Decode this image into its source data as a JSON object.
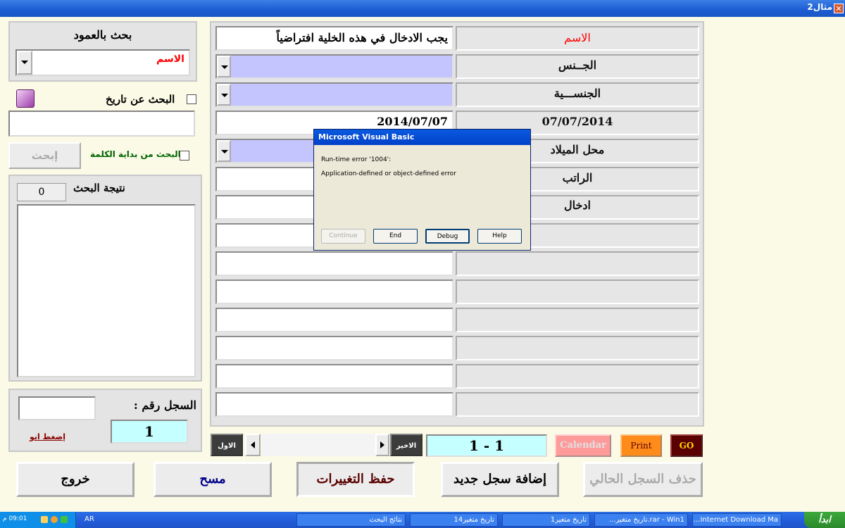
{
  "window": {
    "title": "مثال2",
    "close_glyph": "✕"
  },
  "search": {
    "column_label": "بحث بالعمود",
    "column_value": "الاسم",
    "date_checkbox_label": "البحث عن تاريخ",
    "word_start_label": "البحث من بداية الكلمة",
    "search_button": "إبحث",
    "result_label": "نتيجة البحث",
    "result_count": "0"
  },
  "record": {
    "label": "السجل رقم :",
    "number": "1",
    "press_label": "إضغط انو"
  },
  "form": {
    "labels": [
      "الاسم",
      "الجــنس",
      "الجنســـية",
      "07/07/2014",
      "محل الميلاد",
      "الراتب",
      "ادخال"
    ],
    "name_value": "يجب الادخال في هذه الخلية افتراضياً",
    "date_value": "2014/07/07"
  },
  "nav": {
    "first": "الاول",
    "last": "الاخير",
    "counter": "1 - 1"
  },
  "actions": {
    "calendar": "Calendar",
    "print": "Print",
    "go": "GO"
  },
  "buttons": {
    "exit": "خروج",
    "clear": "مسح",
    "save": "حفظ التغييرات",
    "add": "إضافة سجل جديد",
    "delete": "حذف السجل الحالي"
  },
  "dialog": {
    "title": "Microsoft Visual Basic",
    "error": "Run-time error '1004':",
    "message": "Application-defined or object-defined error",
    "continue": "Continue",
    "end": "End",
    "debug": "Debug",
    "help": "Help"
  },
  "taskbar": {
    "start": "ابدأ",
    "clock": "09:01 م",
    "lang": "AR",
    "tasks": [
      "نتائج البحث",
      "تاريخ متغير14",
      "تاريخ متغير1",
      "rar - Win1.تاريخ متغير...",
      "Internet Download Ma..."
    ]
  },
  "colors": {
    "title_red": "#ff0000",
    "combo_fill": "#c4c4ff",
    "counter_fill": "#c6ffff",
    "calendar": "#ff9a9a",
    "print": "#ff8c1a",
    "go": "#5a0000"
  }
}
